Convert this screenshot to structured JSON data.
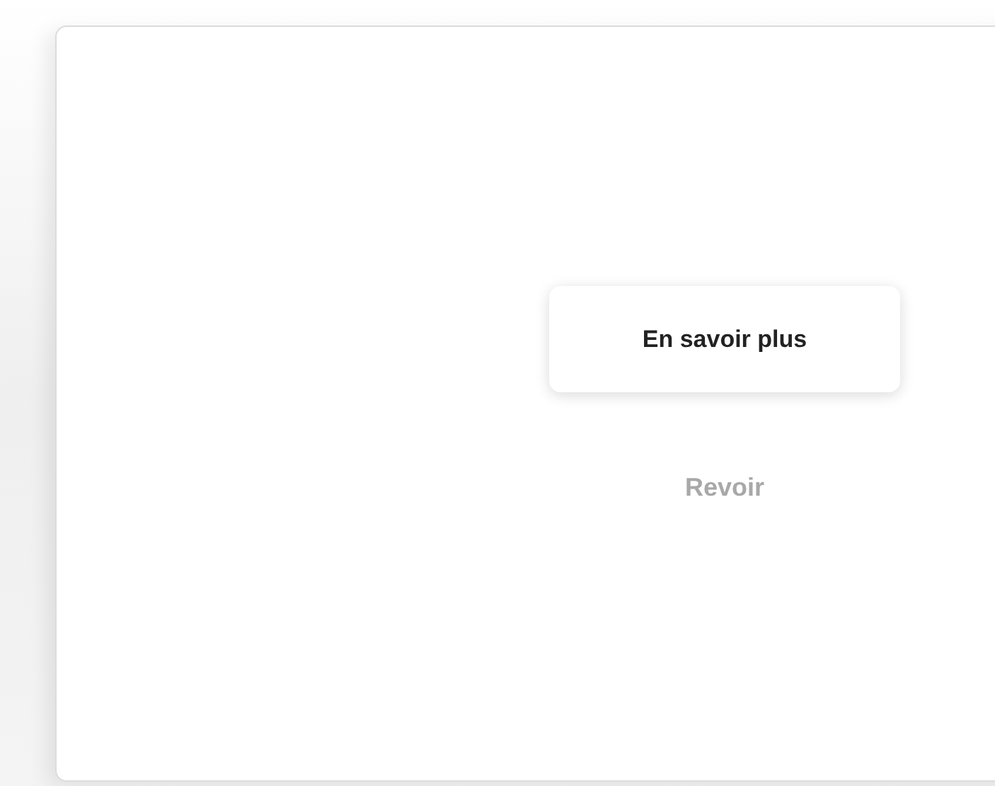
{
  "buttons": [
    {
      "label": "En savoir plus",
      "kind": "raised"
    },
    {
      "label": "Revoir",
      "kind": "flat"
    }
  ]
}
